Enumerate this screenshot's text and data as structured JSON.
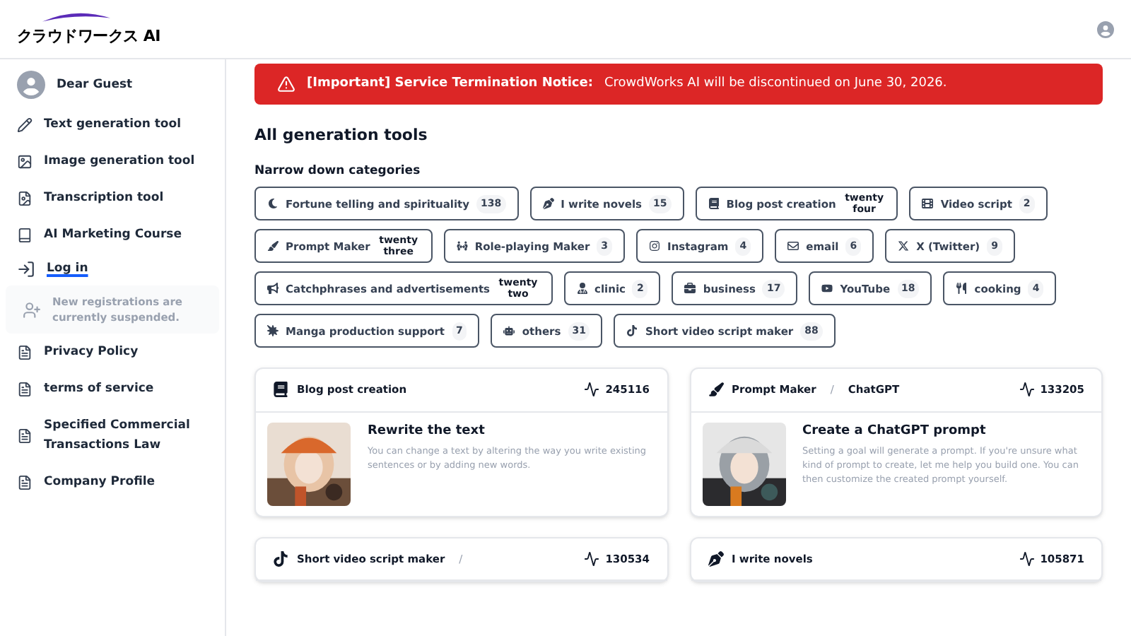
{
  "header": {
    "logo": "クラウドワークス AI"
  },
  "sidebar": {
    "user": "Dear Guest",
    "items": [
      {
        "kind": "link",
        "label": "Text generation tool"
      },
      {
        "kind": "link",
        "label": "Image generation tool"
      },
      {
        "kind": "link",
        "label": "Transcription tool"
      },
      {
        "kind": "link",
        "label": "AI Marketing Course"
      },
      {
        "kind": "login",
        "label": "Log in"
      },
      {
        "kind": "notice",
        "label": "New registrations are currently suspended."
      },
      {
        "kind": "link",
        "label": "Privacy Policy"
      },
      {
        "kind": "link",
        "label": "terms of service"
      },
      {
        "kind": "link",
        "label": "Specified Commercial Transactions Law"
      },
      {
        "kind": "link",
        "label": "Company Profile"
      }
    ]
  },
  "notice": {
    "title": "[Important] Service Termination Notice:",
    "message": "CrowdWorks AI will be discontinued on June 30, 2026."
  },
  "heading": "All generation tools",
  "categories_heading": "Narrow down categories",
  "categories": [
    {
      "label": "Fortune telling and spirituality",
      "count": "138"
    },
    {
      "label": "I write novels",
      "count": "15"
    },
    {
      "label": "Blog post creation",
      "count": "twenty four"
    },
    {
      "label": "Video script",
      "count": "2"
    },
    {
      "label": "Prompt Maker",
      "count": "twenty three"
    },
    {
      "label": "Role-playing Maker",
      "count": "3"
    },
    {
      "label": "Instagram",
      "count": "4"
    },
    {
      "label": "email",
      "count": "6"
    },
    {
      "label": "X (Twitter)",
      "count": "9"
    },
    {
      "label": "Catchphrases and advertisements",
      "count": "twenty two"
    },
    {
      "label": "clinic",
      "count": "2"
    },
    {
      "label": "business",
      "count": "17"
    },
    {
      "label": "YouTube",
      "count": "18"
    },
    {
      "label": "cooking",
      "count": "4"
    },
    {
      "label": "Manga production support",
      "count": "7"
    },
    {
      "label": "others",
      "count": "31"
    },
    {
      "label": "Short video script maker",
      "count": "88"
    }
  ],
  "tools": [
    {
      "category": "Blog post creation",
      "count": "245116",
      "title": "Rewrite the text",
      "description": "You can change a text by altering the way you write existing sentences or by adding new words."
    },
    {
      "category": "Prompt Maker",
      "separator": "/",
      "subcategory": "ChatGPT",
      "count": "133205",
      "title": "Create a ChatGPT prompt",
      "description": "Setting a goal will generate a prompt. If you're unsure what kind of prompt to create, let me help you build one. You can then customize the created prompt yourself."
    },
    {
      "category": "Short video script maker",
      "separator": "/",
      "count": "130534"
    },
    {
      "category": "I write novels",
      "count": "105871"
    }
  ]
}
